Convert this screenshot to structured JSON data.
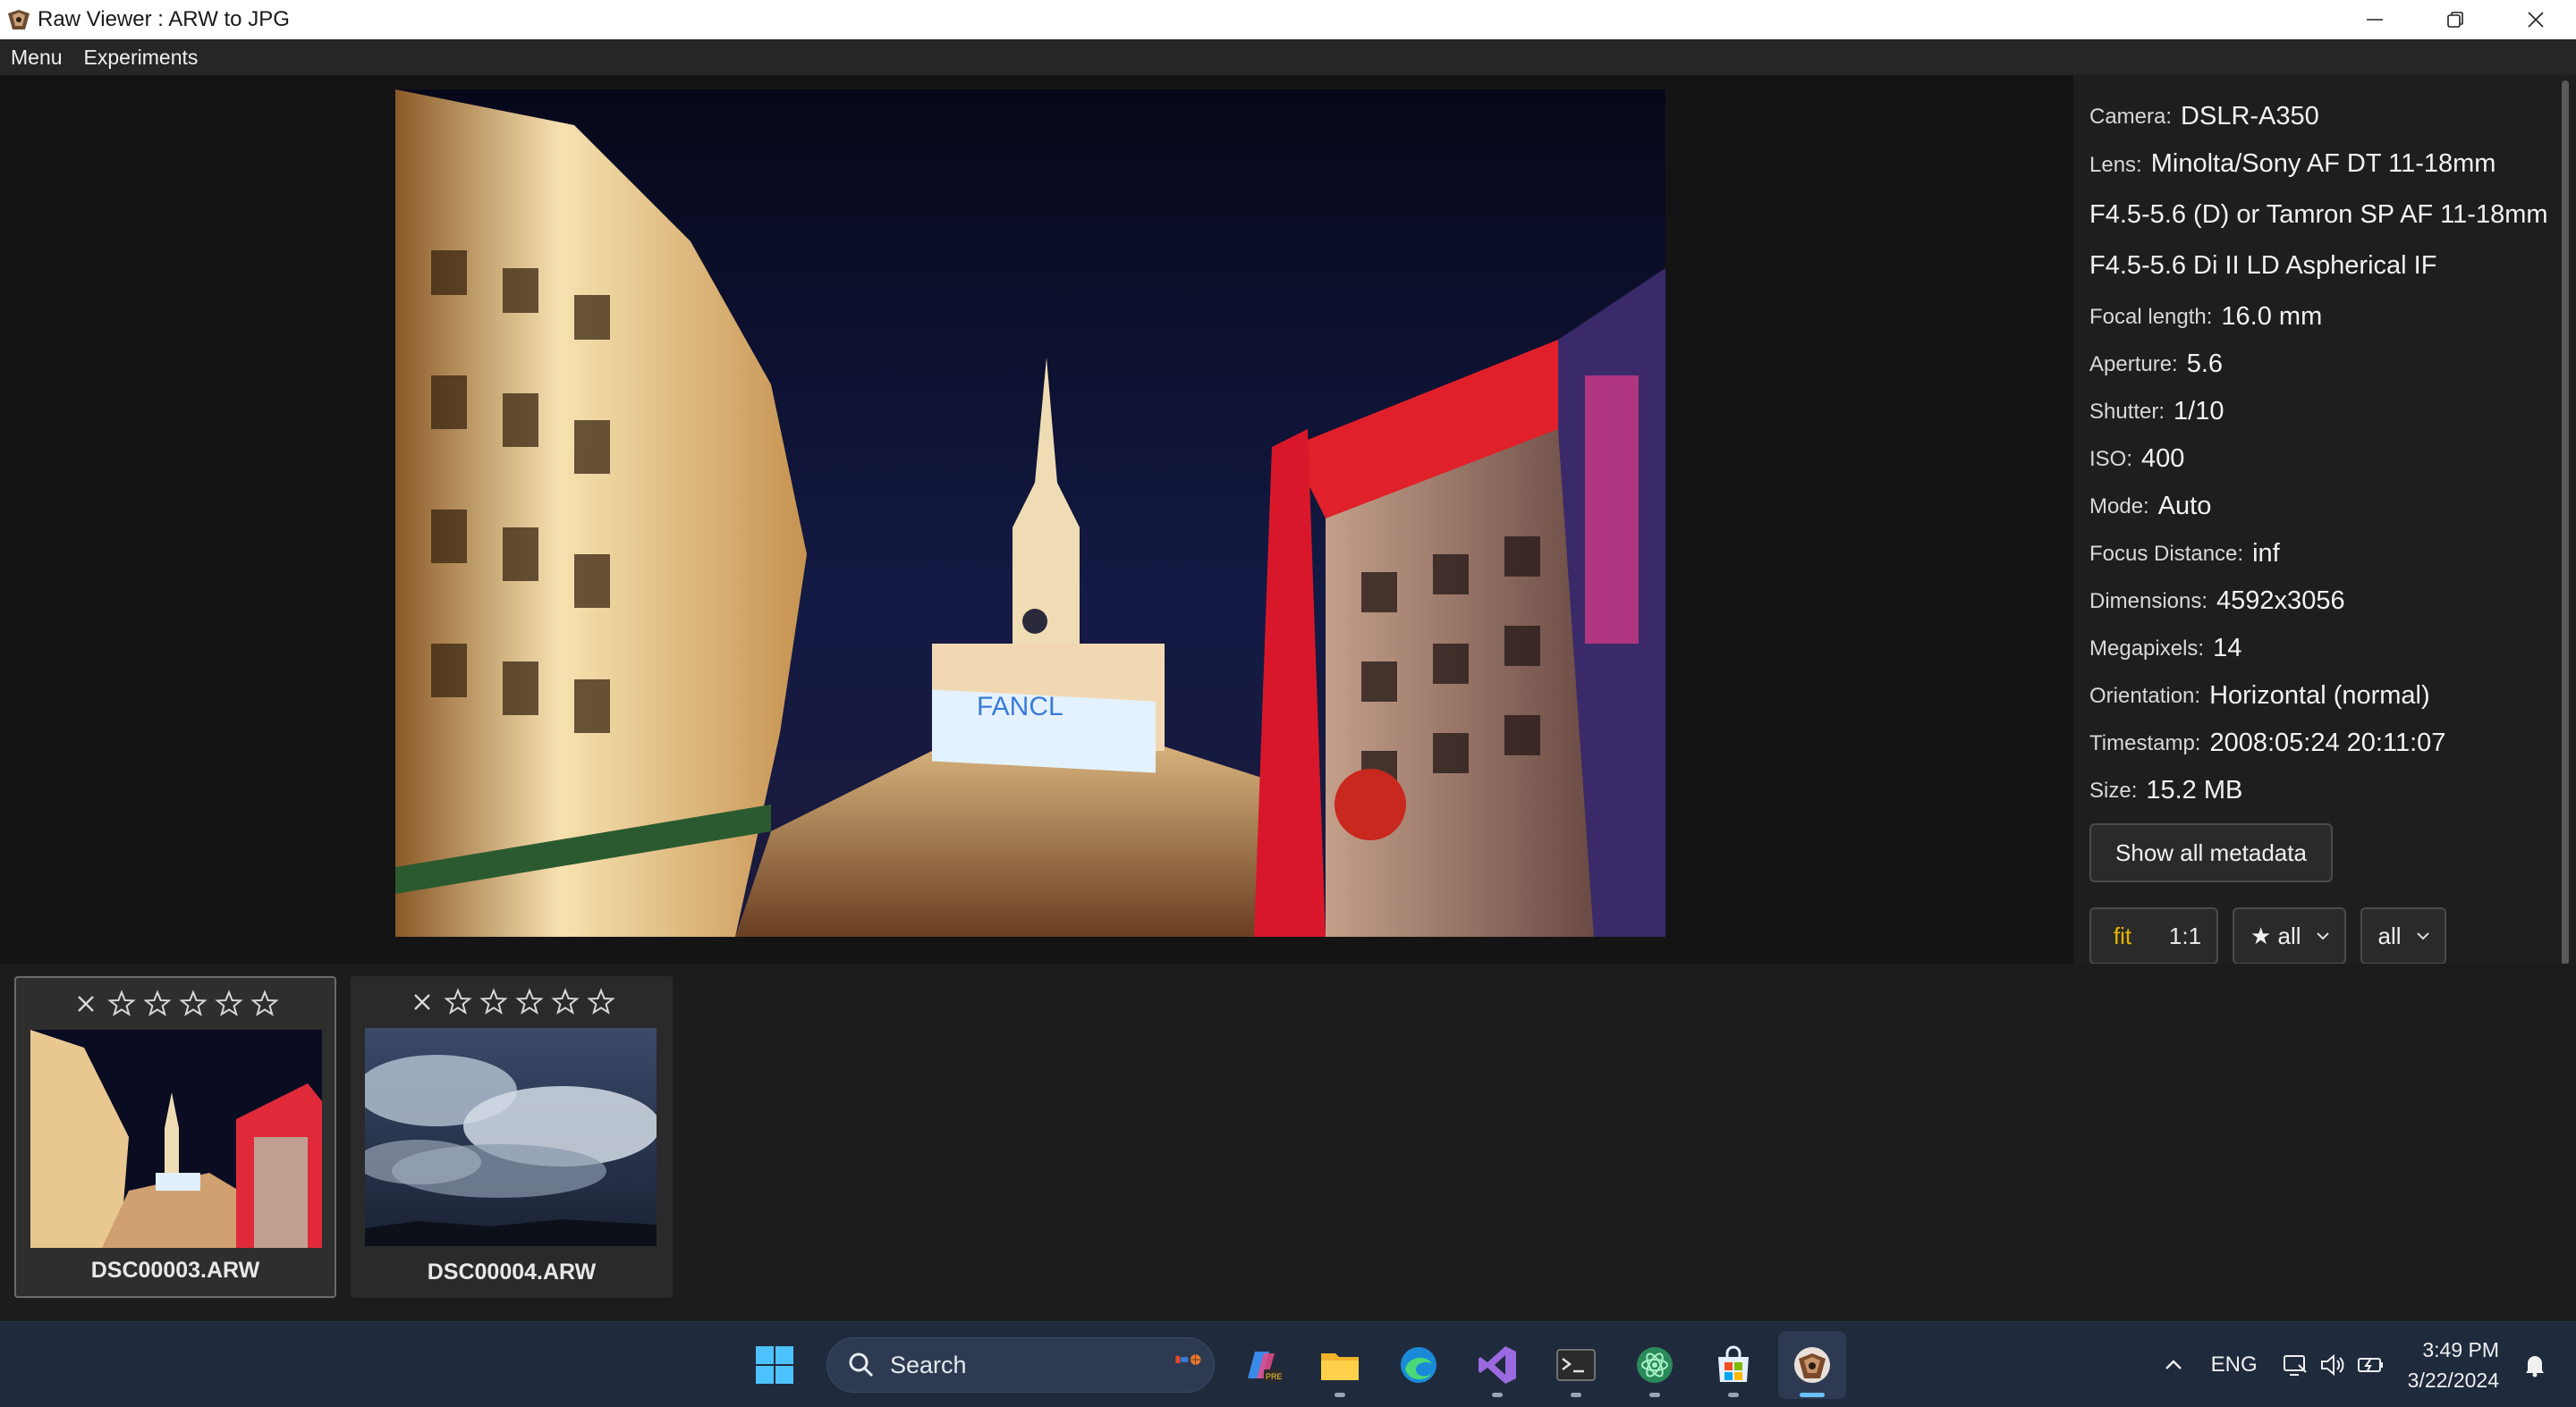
{
  "window": {
    "title": "Raw Viewer : ARW to JPG",
    "controls": [
      "minimize-icon",
      "restore-icon",
      "close-icon"
    ]
  },
  "menubar": {
    "items": [
      {
        "label": "Menu"
      },
      {
        "label": "Experiments"
      }
    ]
  },
  "metadata": {
    "camera": {
      "key": "Camera:",
      "value": "DSLR-A350"
    },
    "lens": {
      "key": "Lens:",
      "value": "Minolta/Sony AF DT 11-18mm F4.5-5.6 (D) or Tamron SP AF 11-18mm F4.5-5.6 Di II LD Aspherical IF"
    },
    "focal_length": {
      "key": "Focal length:",
      "value": "16.0 mm"
    },
    "aperture": {
      "key": "Aperture:",
      "value": "5.6"
    },
    "shutter": {
      "key": "Shutter:",
      "value": "1/10"
    },
    "iso": {
      "key": "ISO:",
      "value": "400"
    },
    "mode": {
      "key": "Mode:",
      "value": "Auto"
    },
    "focus_distance": {
      "key": "Focus Distance:",
      "value": "inf"
    },
    "dimensions": {
      "key": "Dimensions:",
      "value": "4592x3056"
    },
    "megapixels": {
      "key": "Megapixels:",
      "value": "14"
    },
    "orientation": {
      "key": "Orientation:",
      "value": "Horizontal (normal)"
    },
    "timestamp": {
      "key": "Timestamp:",
      "value": "2008:05:24 20:11:07"
    },
    "size": {
      "key": "Size:",
      "value": "15.2 MB"
    }
  },
  "controls": {
    "show_all_label": "Show all metadata",
    "zoom_fit": "fit",
    "zoom_1to1": "1:1",
    "rating_filter": "★ all",
    "type_filter": "all"
  },
  "thumbnails": [
    {
      "name": "DSC00003.ARW",
      "rating": 0,
      "selected": true
    },
    {
      "name": "DSC00004.ARW",
      "rating": 0,
      "selected": false
    }
  ],
  "taskbar": {
    "search_placeholder": "Search",
    "language": "ENG",
    "time": "3:49 PM",
    "date": "3/22/2024"
  },
  "colors": {
    "accent_active": "#e8b400",
    "taskbar_bg": "#1f2a3d",
    "panel_bg": "#1e1e1e"
  }
}
